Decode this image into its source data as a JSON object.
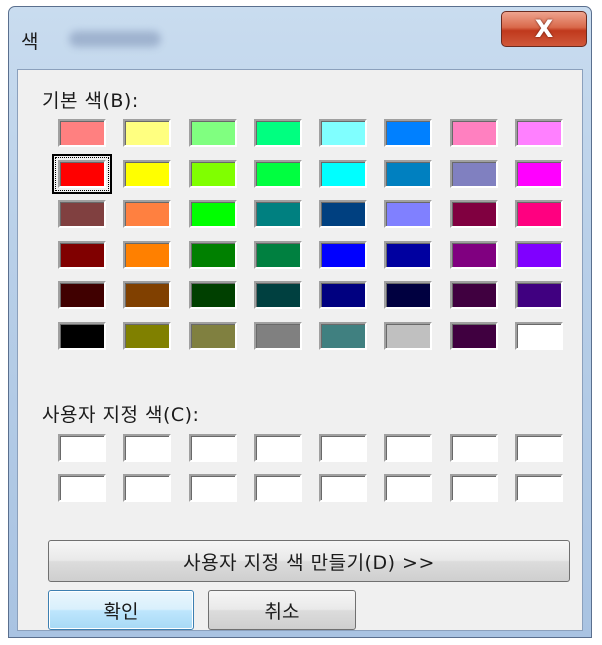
{
  "window": {
    "title": "색",
    "close_glyph": "X",
    "close_icon": "close-icon"
  },
  "basic_colors": {
    "label": "기본 색(B):",
    "selected_index": 8,
    "colors": [
      "#FF8080",
      "#FFFF80",
      "#80FF80",
      "#00FF80",
      "#80FFFF",
      "#0080FF",
      "#FF80C0",
      "#FF80FF",
      "#FF0000",
      "#FFFF00",
      "#80FF00",
      "#00FF40",
      "#00FFFF",
      "#0080C0",
      "#8080C0",
      "#FF00FF",
      "#804040",
      "#FF8040",
      "#00FF00",
      "#008080",
      "#004080",
      "#8080FF",
      "#800040",
      "#FF0080",
      "#800000",
      "#FF8000",
      "#008000",
      "#008040",
      "#0000FF",
      "#0000A0",
      "#800080",
      "#8000FF",
      "#400000",
      "#804000",
      "#004000",
      "#004040",
      "#000080",
      "#000040",
      "#400040",
      "#400080",
      "#000000",
      "#808000",
      "#808040",
      "#808080",
      "#408080",
      "#C0C0C0",
      "#400040",
      "#FFFFFF"
    ]
  },
  "custom_colors": {
    "label": "사용자 지정 색(C):",
    "colors": [
      "#FFFFFF",
      "#FFFFFF",
      "#FFFFFF",
      "#FFFFFF",
      "#FFFFFF",
      "#FFFFFF",
      "#FFFFFF",
      "#FFFFFF",
      "#FFFFFF",
      "#FFFFFF",
      "#FFFFFF",
      "#FFFFFF",
      "#FFFFFF",
      "#FFFFFF",
      "#FFFFFF",
      "#FFFFFF"
    ]
  },
  "buttons": {
    "define_custom": "사용자 지정 색 만들기(D) >>",
    "ok": "확인",
    "cancel": "취소"
  }
}
